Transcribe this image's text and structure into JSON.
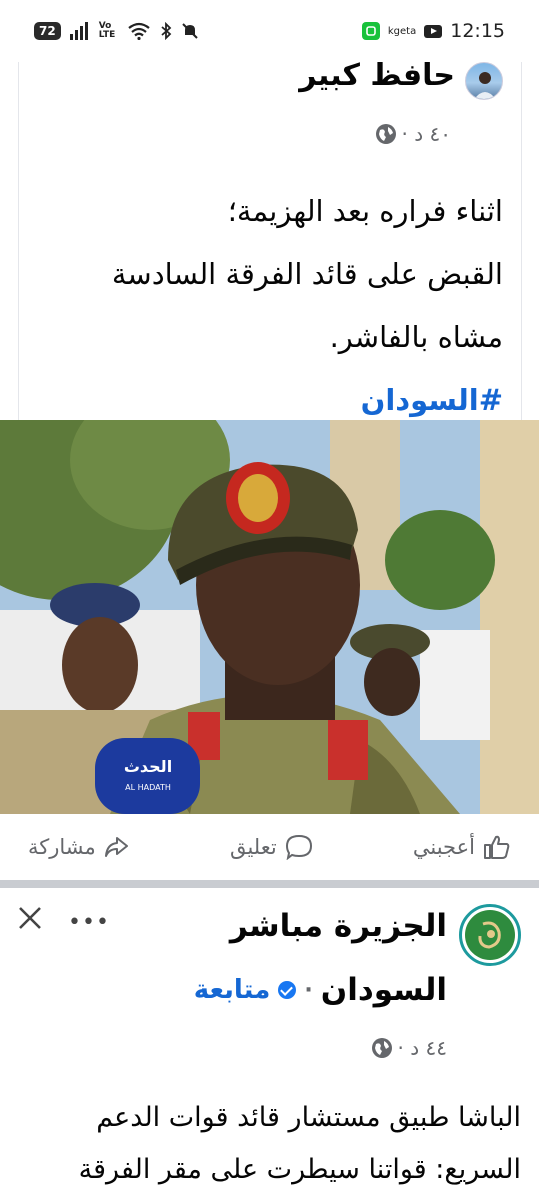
{
  "status_bar": {
    "battery": "72",
    "volte": "Vo LTE",
    "app_label": "kgeta",
    "time": "12:15"
  },
  "post1": {
    "author": "حافظ كبير",
    "time": "٤٠ د ·",
    "lines": [
      "اثناء فراره بعد الهزيمة؛",
      "القبض على قائد الفرقة السادسة",
      "مشاه بالفاشر."
    ],
    "hashtag": "#السودان",
    "photo": {
      "mic_logo": "الحدث",
      "mic_subtext": "AL HADATH"
    }
  },
  "actions": {
    "like": "أعجبني",
    "comment": "تعليق",
    "share": "مشاركة"
  },
  "post2": {
    "author_line1": "الجزيرة مباشر",
    "author_line2": "السودان",
    "follow": "متابعة",
    "time": "٤٤ د ·",
    "lines": [
      "الباشا طبيق مستشار قائد قوات الدعم",
      "السريع: قواتنا سيطرت على مقر الفرقة"
    ]
  },
  "colors": {
    "link_blue": "#1567d3",
    "verified_blue": "#1877f2",
    "meta_gray": "#65676b"
  }
}
